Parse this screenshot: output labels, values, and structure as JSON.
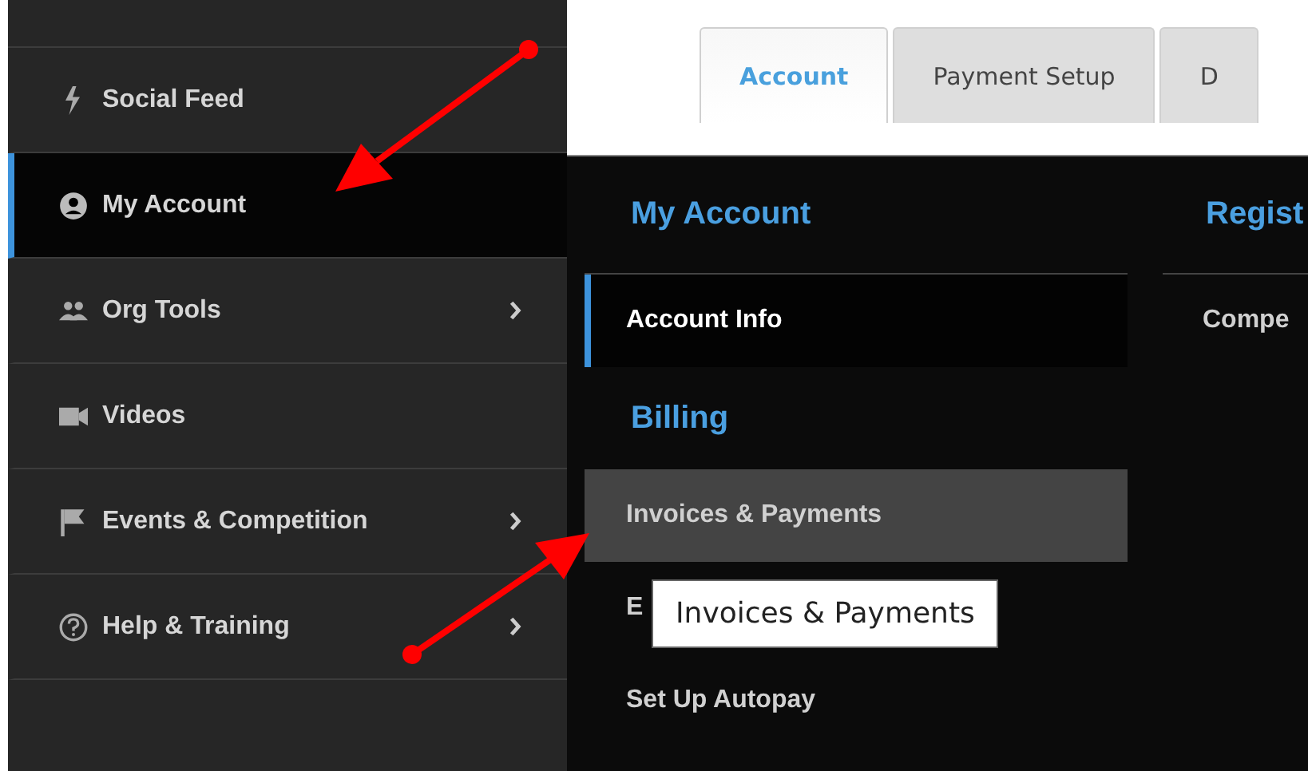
{
  "sidebar": {
    "items": [
      {
        "label": "Social Feed",
        "kind": "bolt",
        "selected": false,
        "submenu": false
      },
      {
        "label": "My Account",
        "kind": "user",
        "selected": true,
        "submenu": false
      },
      {
        "label": "Org Tools",
        "kind": "people",
        "selected": false,
        "submenu": true
      },
      {
        "label": "Videos",
        "kind": "camera",
        "selected": false,
        "submenu": false
      },
      {
        "label": "Events & Competition",
        "kind": "flag",
        "selected": false,
        "submenu": true
      },
      {
        "label": "Help & Training",
        "kind": "help",
        "selected": false,
        "submenu": true
      }
    ]
  },
  "tabs": [
    {
      "label": "Account",
      "selected": true
    },
    {
      "label": "Payment Setup",
      "selected": false
    },
    {
      "label": "D",
      "selected": false
    }
  ],
  "menu": {
    "columns": [
      {
        "sections": [
          {
            "heading": "My Account",
            "items": [
              {
                "label": "Account Info",
                "selected": true,
                "hovered": false
              }
            ]
          },
          {
            "heading": "Billing",
            "items": [
              {
                "label": "Invoices & Payments",
                "selected": false,
                "hovered": true
              },
              {
                "label": "E",
                "selected": false,
                "hovered": false
              },
              {
                "label": "Set Up Autopay",
                "selected": false,
                "hovered": false
              }
            ]
          }
        ]
      },
      {
        "sections": [
          {
            "heading": "Regist",
            "items": [
              {
                "label": "Compe",
                "selected": false,
                "hovered": false
              }
            ]
          }
        ]
      }
    ]
  },
  "tooltip": {
    "text": "Invoices & Payments"
  }
}
